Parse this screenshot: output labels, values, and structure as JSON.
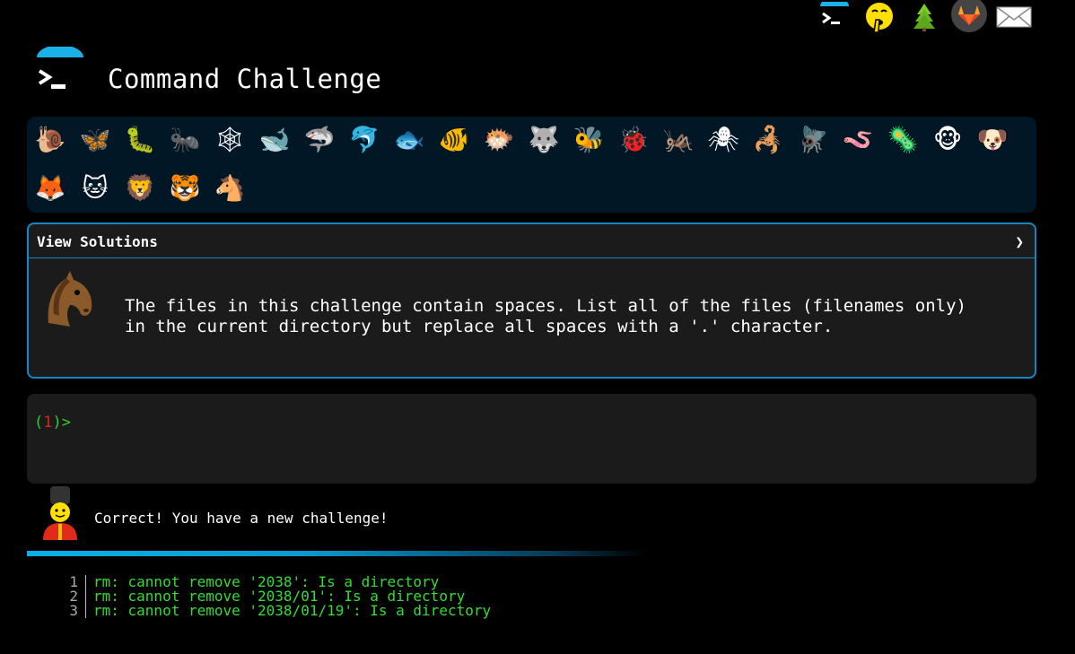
{
  "header": {
    "title": "Command Challenge",
    "topbar_icons": [
      "terminal-icon",
      "shushing-face-icon",
      "tree-icon",
      "gitlab-icon",
      "mail-icon"
    ]
  },
  "animals": [
    {
      "name": "snail",
      "glyph": "🐌"
    },
    {
      "name": "butterfly",
      "glyph": "🦋"
    },
    {
      "name": "caterpillar",
      "glyph": "🐛"
    },
    {
      "name": "ant",
      "glyph": "🐜"
    },
    {
      "name": "spider-web",
      "glyph": "🕸"
    },
    {
      "name": "whale",
      "glyph": "🐋"
    },
    {
      "name": "shark",
      "glyph": "🦈"
    },
    {
      "name": "dolphin",
      "glyph": "🐬"
    },
    {
      "name": "fish",
      "glyph": "🐟"
    },
    {
      "name": "tropical-fish",
      "glyph": "🐠"
    },
    {
      "name": "blowfish",
      "glyph": "🐡"
    },
    {
      "name": "wolf",
      "glyph": "🐺"
    },
    {
      "name": "bee",
      "glyph": "🐝"
    },
    {
      "name": "ladybug",
      "glyph": "🐞"
    },
    {
      "name": "cricket",
      "glyph": "🦗"
    },
    {
      "name": "spider",
      "glyph": "🕷"
    },
    {
      "name": "scorpion",
      "glyph": "🦂"
    },
    {
      "name": "fly",
      "glyph": "🪰"
    },
    {
      "name": "worm",
      "glyph": "🪱"
    },
    {
      "name": "microbe",
      "glyph": "🦠"
    },
    {
      "name": "monkey",
      "glyph": "🐵"
    },
    {
      "name": "dog",
      "glyph": "🐶"
    },
    {
      "name": "fox",
      "glyph": "🦊"
    },
    {
      "name": "cat",
      "glyph": "🐱"
    },
    {
      "name": "lion",
      "glyph": "🦁"
    },
    {
      "name": "tiger",
      "glyph": "🐯"
    },
    {
      "name": "horse",
      "glyph": "🐴"
    }
  ],
  "solutions": {
    "header_label": "View Solutions",
    "chevron": "❯",
    "challenge_lines": "The files in this challenge contain spaces. List all of the files (filenames only)\nin the current directory but replace all spaces with a '.' character."
  },
  "terminal": {
    "prompt_open": "(",
    "prompt_num": "1",
    "prompt_close": ")>",
    "input_value": ""
  },
  "result": {
    "message": "Correct! You have a new challenge!"
  },
  "output": [
    {
      "num": "1",
      "text": "rm: cannot remove '2038': Is a directory"
    },
    {
      "num": "2",
      "text": "rm: cannot remove '2038/01': Is a directory"
    },
    {
      "num": "3",
      "text": "rm: cannot remove '2038/01/19': Is a directory"
    }
  ],
  "colors": {
    "accent": "#1a86c0",
    "prompt_green": "#33cc33",
    "prompt_red": "#e02020",
    "output_green": "#33dd33",
    "animal_panel_bg": "#011726"
  }
}
